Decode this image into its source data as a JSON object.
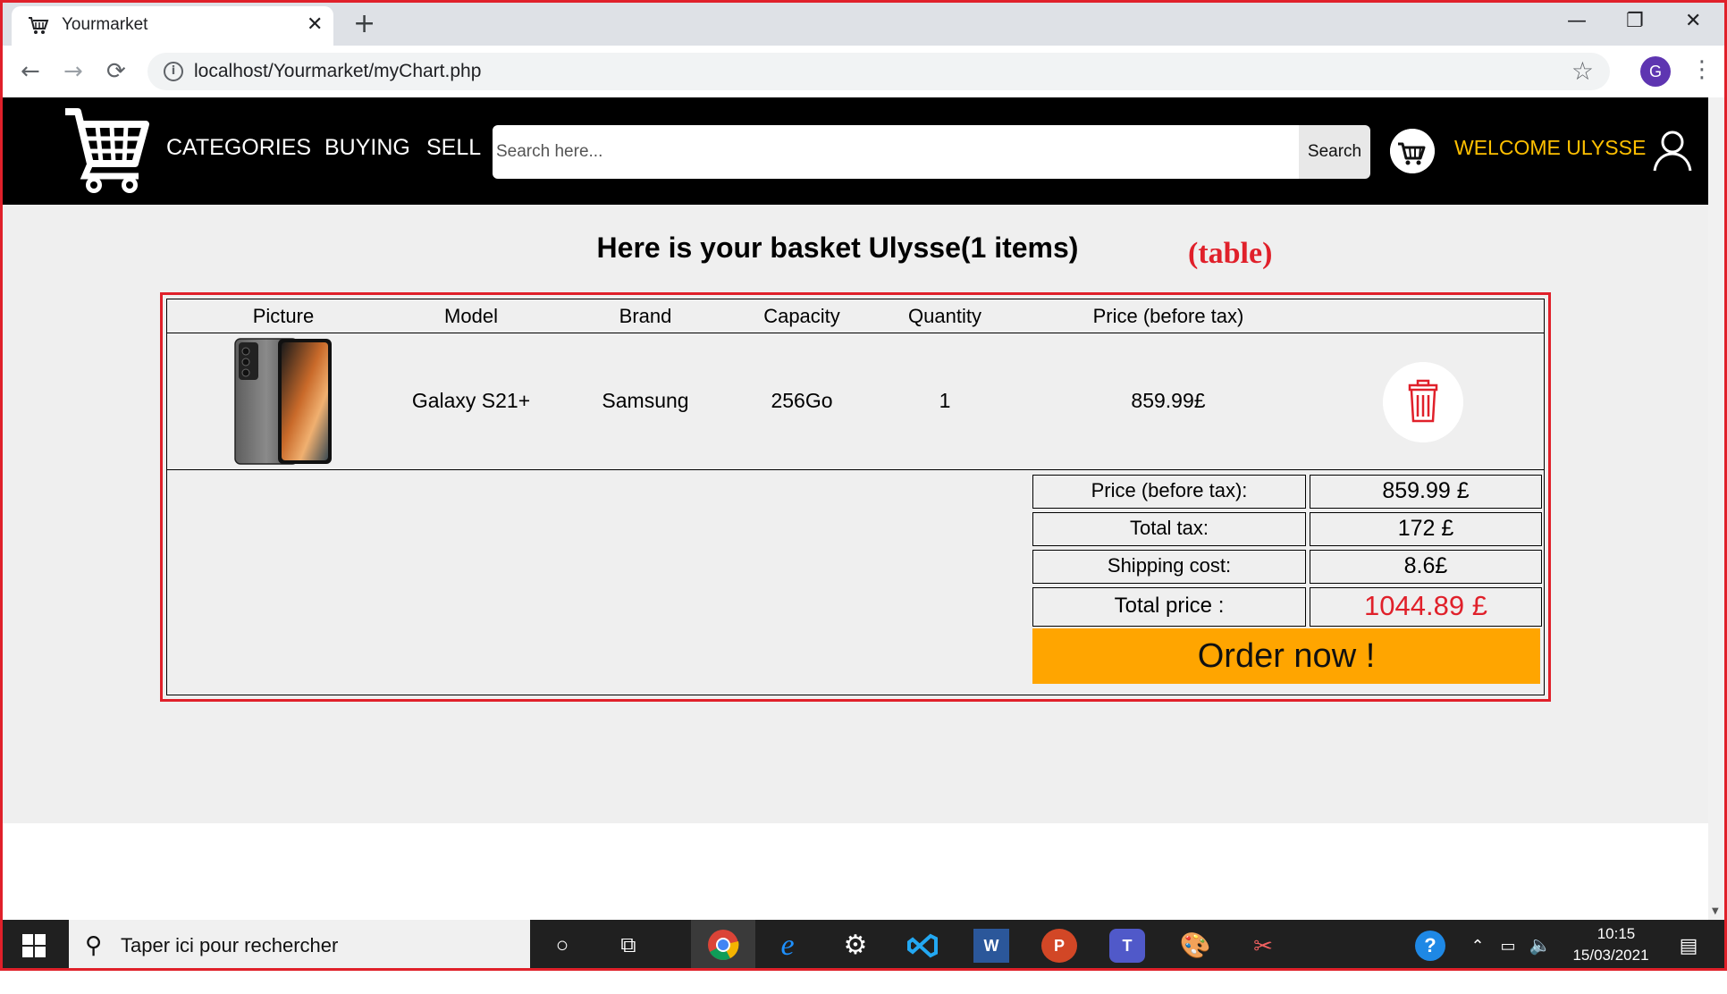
{
  "browser": {
    "tab_title": "Yourmarket",
    "tab_close": "✕",
    "new_tab": "+",
    "url": "localhost/Yourmarket/myChart.php",
    "profile_initial": "G",
    "window_controls": {
      "minimize": "—",
      "restore": "❐",
      "close": "✕"
    }
  },
  "site": {
    "nav": {
      "categories": "CATEGORIES",
      "buying": "BUYING",
      "sell": "SELL"
    },
    "search": {
      "placeholder": "Search here...",
      "button": "Search"
    },
    "welcome": "WELCOME ULYSSE"
  },
  "basket": {
    "title": "Here is your basket Ulysse(1 items)",
    "annotation": "(table)",
    "columns": [
      "Picture",
      "Model",
      "Brand",
      "Capacity",
      "Quantity",
      "Price (before tax)"
    ],
    "items": [
      {
        "model": "Galaxy S21+",
        "brand": "Samsung",
        "capacity": "256Go",
        "quantity": "1",
        "price": "859.99£"
      }
    ],
    "summary": {
      "price_label": "Price (before tax):",
      "price_value": "859.99 £",
      "tax_label": "Total tax:",
      "tax_value": "172 £",
      "shipping_label": "Shipping cost:",
      "shipping_value": "8.6£",
      "total_label": "Total price :",
      "total_value": "1044.89 £"
    },
    "order_button": "Order now !"
  },
  "taskbar": {
    "search_text": "Taper ici pour rechercher",
    "time": "10:15",
    "date": "15/03/2021"
  },
  "colors": {
    "accent_red": "#e0202a",
    "welcome_yellow": "#ffc000",
    "order_orange": "#ffa500"
  }
}
